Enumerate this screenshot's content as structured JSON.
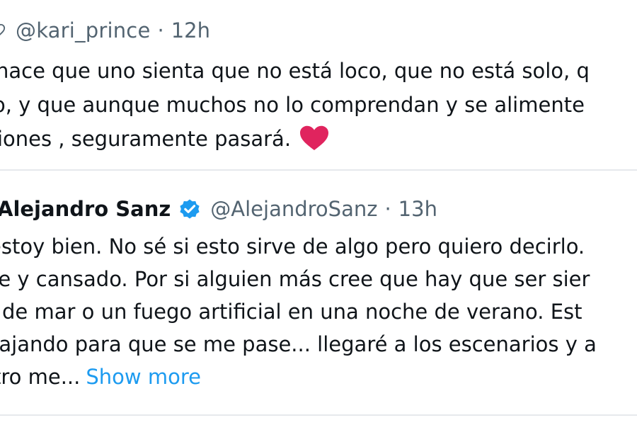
{
  "reply": {
    "handle": "@kari_prince",
    "separator": "·",
    "time": "12h",
    "lines": [
      "hace que uno sienta que no está loco, que no está solo, q",
      "o, y que aunque muchos no lo comprendan y se alimente",
      "ciones , seguramente pasará."
    ],
    "emoji": "red-heart-emoji"
  },
  "quote": {
    "name": "Alejandro Sanz",
    "handle": "@AlejandroSanz",
    "separator": "·",
    "time": "13h",
    "lines": [
      "estoy bien. No sé si esto sirve de algo pero quiero decirlo.",
      "te y cansado. Por si alguien más cree que hay que ser sier",
      "a de mar o un fuego artificial en una noche de verano. Est",
      "bajando para que se me pase... llegaré a los escenarios y a",
      "tro me..."
    ],
    "show_more": "Show more"
  },
  "icons": {
    "like": "heart-outline-icon",
    "verified": "verified-badge-icon"
  },
  "colors": {
    "text": "#0f1419",
    "muted": "#536471",
    "link": "#1d9bf0",
    "verified": "#1d9bf0",
    "heart": "#e0245e",
    "divider": "#e6e9ec"
  }
}
